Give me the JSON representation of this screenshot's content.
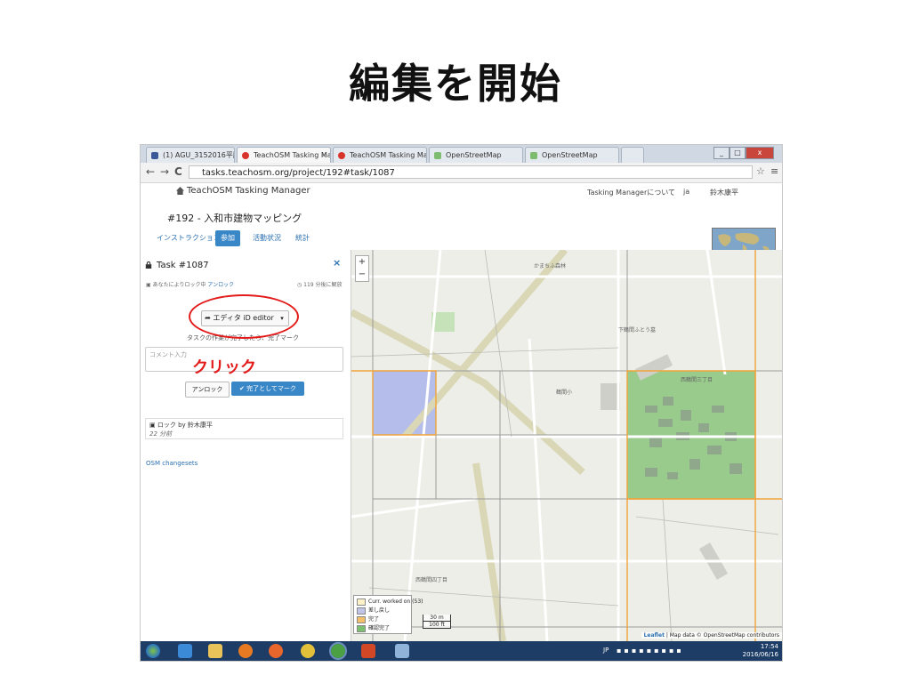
{
  "slide": {
    "title": "編集を開始"
  },
  "browser": {
    "tabs": [
      {
        "label": "(1) AGU_3152016平勝"
      },
      {
        "label": "TeachOSM Tasking Ma"
      },
      {
        "label": "TeachOSM Tasking Ma"
      },
      {
        "label": "OpenStreetMap"
      },
      {
        "label": "OpenStreetMap"
      }
    ],
    "url": "tasks.teachosm.org/project/192#task/1087",
    "back_icon": "←",
    "forward_icon": "→",
    "reload_icon": "C"
  },
  "header": {
    "brand": "TeachOSM Tasking Manager",
    "about": "Tasking Managerについて",
    "lang": "ja",
    "user": "鈴木康平"
  },
  "project": {
    "title": "#192 - 入和市建物マッピング",
    "tabs": [
      "インストラクション",
      "参加",
      "活動状況",
      "統計"
    ]
  },
  "task": {
    "title": "Task #1087",
    "close": "×",
    "lock_info": "あなたによりロック中",
    "lock_link": "アンロック",
    "timer": "119 分後に解放",
    "editor_button": "エディタ iD editor",
    "editor_caret": "▾",
    "tip": "タスクの作業が完了したら、完了マーク",
    "comment_placeholder": "コメント入力",
    "unlock_button": "アンロック",
    "done_button": "完了としてマーク",
    "history_entry": "ロック by 鈴木康平",
    "history_time": "22 分前",
    "changesets": "OSM changesets"
  },
  "annotation": {
    "text": "クリック"
  },
  "map": {
    "zoom_in": "+",
    "zoom_out": "−",
    "labels": [
      "下鶴間ふとう墓",
      "西鶴間三丁目",
      "西鶴間四丁目",
      "鶴間小",
      "かまちふ森林"
    ],
    "legend": [
      {
        "label": "Curr. worked on (53)",
        "color": "#fdf2c8"
      },
      {
        "label": "差し戻し",
        "color": "#c0c4e6"
      },
      {
        "label": "完了",
        "color": "#f2c06a"
      },
      {
        "label": "確認完了",
        "color": "#7cbf6e"
      }
    ],
    "scale": [
      "30 m",
      "100 ft"
    ],
    "attribution_link": "Leaflet",
    "attribution": "| Map data © OpenStreetMap contributors"
  },
  "taskbar": {
    "clock": "17:54",
    "date": "2016/06/16",
    "lang": "JP"
  }
}
